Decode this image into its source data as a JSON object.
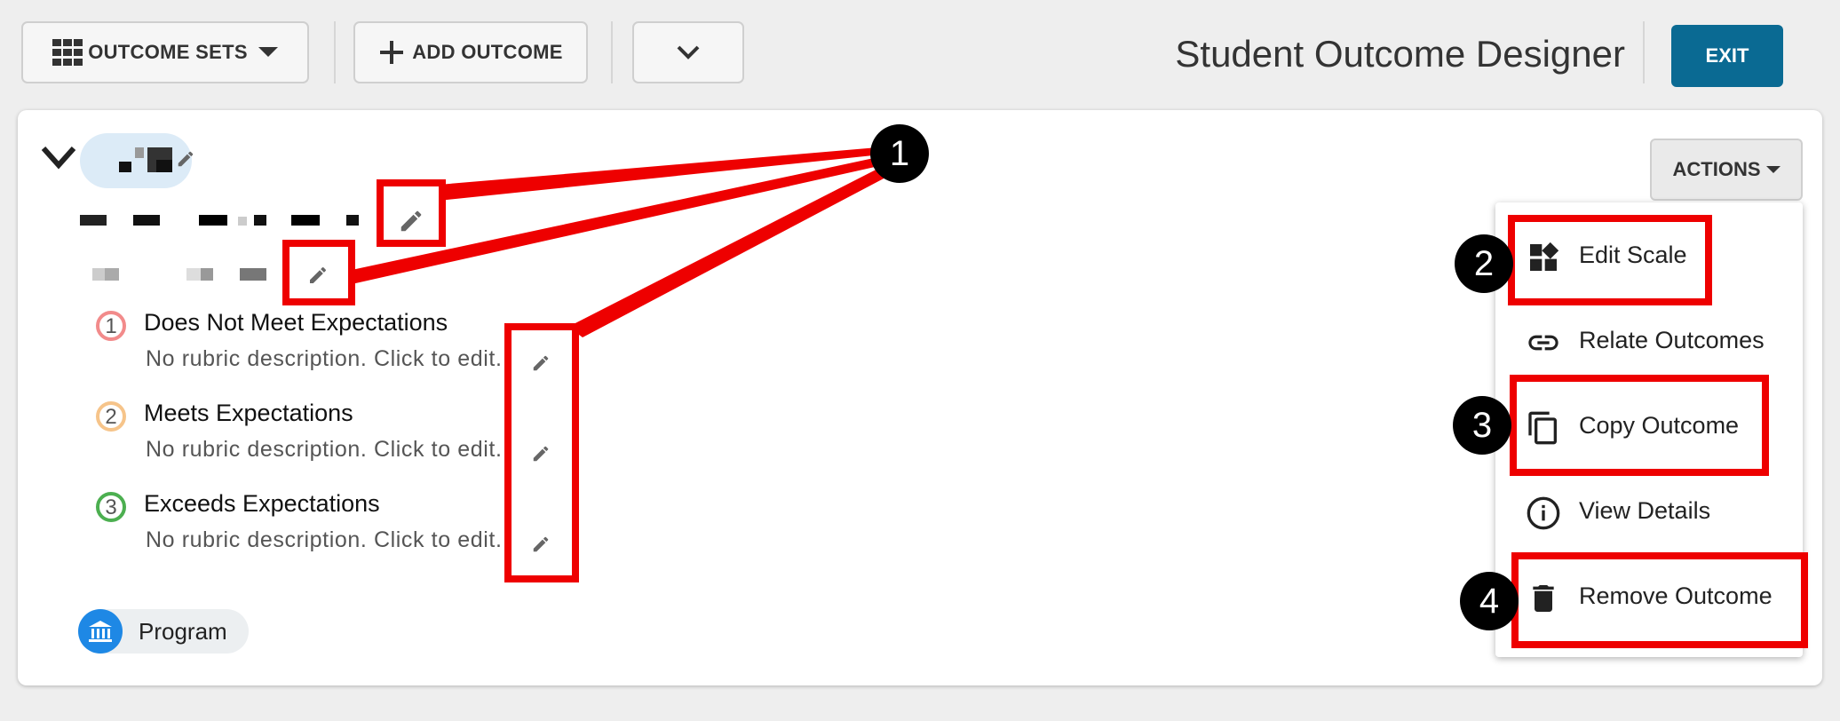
{
  "toolbar": {
    "outcome_sets_label": "OUTCOME SETS",
    "add_outcome_label": "ADD OUTCOME",
    "app_title": "Student Outcome Designer",
    "exit_label": "EXIT"
  },
  "outcome": {
    "rubric_levels": [
      {
        "number": "1",
        "title": "Does Not Meet Expectations",
        "description": "No rubric description. Click to edit.",
        "color": "#f28b8b"
      },
      {
        "number": "2",
        "title": "Meets Expectations",
        "description": "No rubric description. Click to edit.",
        "color": "#f6c48a"
      },
      {
        "number": "3",
        "title": "Exceeds Expectations",
        "description": "No rubric description. Click to edit.",
        "color": "#4caf50"
      }
    ],
    "program_label": "Program"
  },
  "actions": {
    "button_label": "ACTIONS",
    "menu": [
      {
        "label": "Edit Scale",
        "icon": "widgets-icon"
      },
      {
        "label": "Relate Outcomes",
        "icon": "link-icon"
      },
      {
        "label": "Copy Outcome",
        "icon": "copy-icon"
      },
      {
        "label": "View Details",
        "icon": "info-icon"
      },
      {
        "label": "Remove Outcome",
        "icon": "trash-icon"
      }
    ]
  },
  "annotations": {
    "callouts": [
      "1",
      "2",
      "3",
      "4"
    ],
    "color": "#ee0000"
  }
}
